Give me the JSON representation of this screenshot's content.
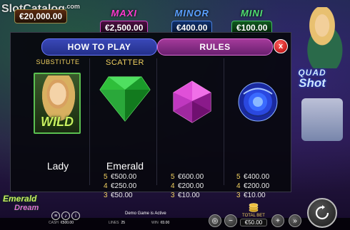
{
  "watermark": {
    "text": "SlotCatalog",
    "suffix": ".com"
  },
  "jackpots": [
    {
      "name": "",
      "value": "€20,000.00"
    },
    {
      "name": "MAXI",
      "value": "€2,500.00"
    },
    {
      "name": "MINOR",
      "value": "€400.00"
    },
    {
      "name": "MINI",
      "value": "€100.00"
    }
  ],
  "side_logo": {
    "line1": "QUAD",
    "line2": "Shot"
  },
  "modal": {
    "tabs": {
      "how_to_play": "HOW TO PLAY",
      "rules": "RULES"
    },
    "close_glyph": "x",
    "symbols": [
      {
        "caption": "SUBSTITUTE",
        "badge": "WILD",
        "name": "Lady",
        "pays": []
      },
      {
        "caption": "SCATTER",
        "name": "Emerald",
        "gem_color": "#2fcf40",
        "pays": [
          {
            "count": "5",
            "value": "€500.00"
          },
          {
            "count": "4",
            "value": "€250.00"
          },
          {
            "count": "3",
            "value": "€50.00"
          }
        ]
      },
      {
        "caption": "",
        "name": "",
        "gem_color": "#e050d0",
        "pays": [
          {
            "count": "5",
            "value": "€600.00"
          },
          {
            "count": "4",
            "value": "€200.00"
          },
          {
            "count": "3",
            "value": "€10.00"
          }
        ]
      },
      {
        "caption": "",
        "name": "",
        "gem_color": "#3a60ff",
        "pays": [
          {
            "count": "5",
            "value": "€400.00"
          },
          {
            "count": "4",
            "value": "€200.00"
          },
          {
            "count": "3",
            "value": "€10.00"
          }
        ]
      }
    ]
  },
  "bottom_logo": {
    "line1": "Emerald",
    "line2": "Dream"
  },
  "bottom_bar": {
    "demo_text": "Demo Game is Active",
    "cash_label": "CASH",
    "cash_value": "€500.00",
    "lines_label": "LINES",
    "lines_value": "25",
    "win_label": "WIN",
    "win_value": "€0.00",
    "total_bet_label": "TOTAL BET",
    "total_bet_value": "€50.00",
    "minus_glyph": "−",
    "plus_glyph": "+",
    "info_glyph": "i"
  }
}
